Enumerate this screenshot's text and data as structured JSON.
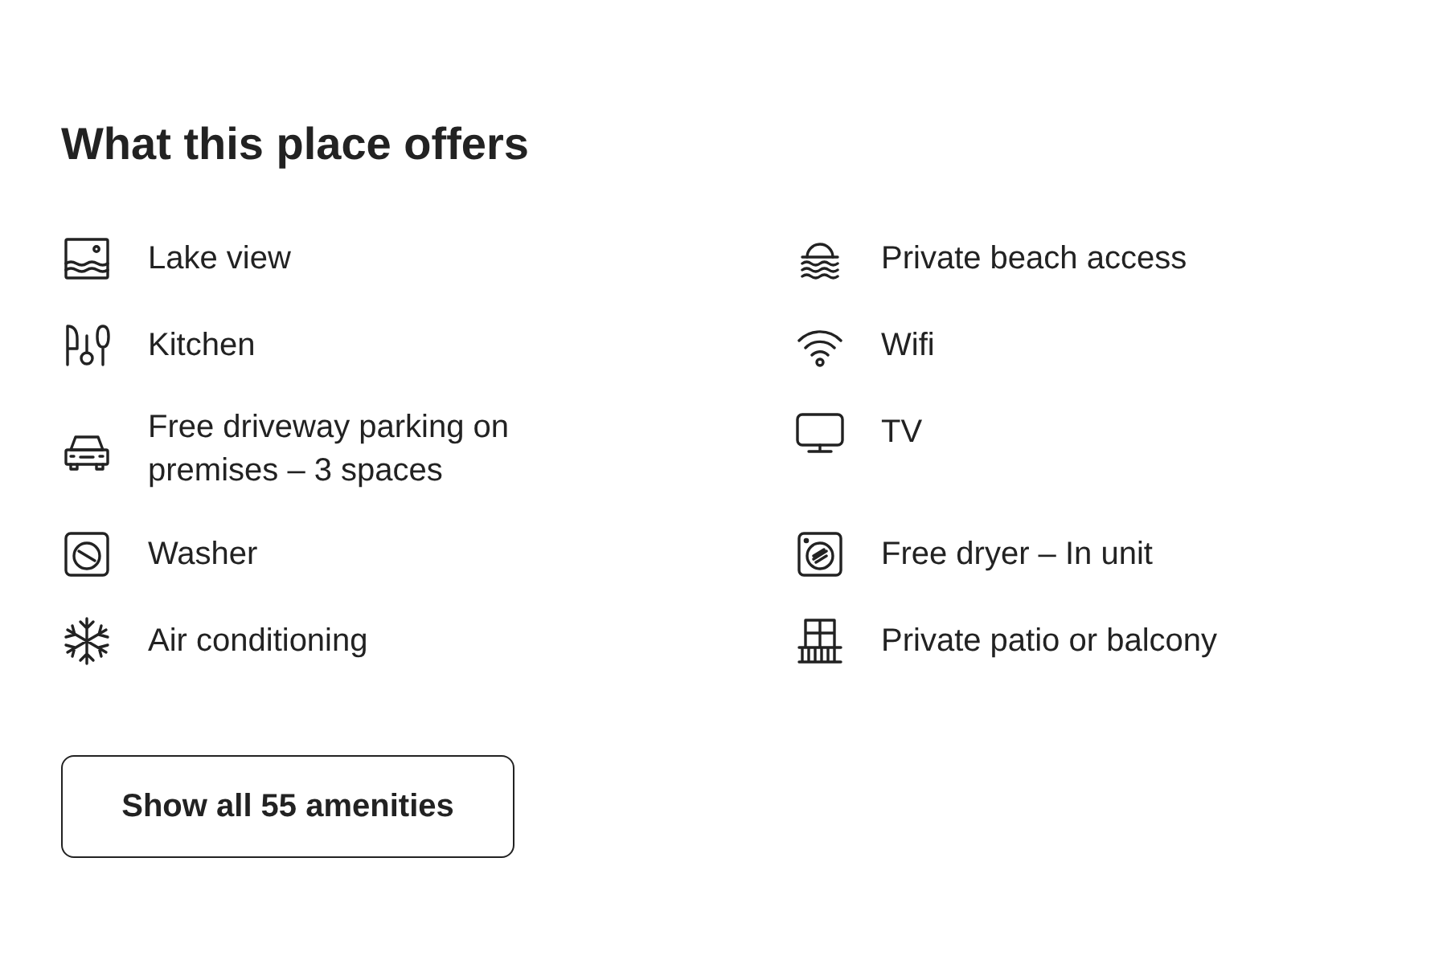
{
  "section": {
    "title": "What this place offers"
  },
  "amenities": [
    {
      "kind": "lake",
      "label": "Lake view"
    },
    {
      "kind": "beach",
      "label": "Private beach access"
    },
    {
      "kind": "kitchen",
      "label": "Kitchen"
    },
    {
      "kind": "wifi",
      "label": "Wifi"
    },
    {
      "kind": "car",
      "label": "Free driveway parking on premises – 3 spaces"
    },
    {
      "kind": "tv",
      "label": "TV"
    },
    {
      "kind": "washer",
      "label": "Washer"
    },
    {
      "kind": "dryer",
      "label": "Free dryer – In unit"
    },
    {
      "kind": "snow",
      "label": "Air conditioning"
    },
    {
      "kind": "balcony",
      "label": "Private patio or balcony"
    }
  ],
  "button": {
    "label": "Show all 55 amenities"
  }
}
